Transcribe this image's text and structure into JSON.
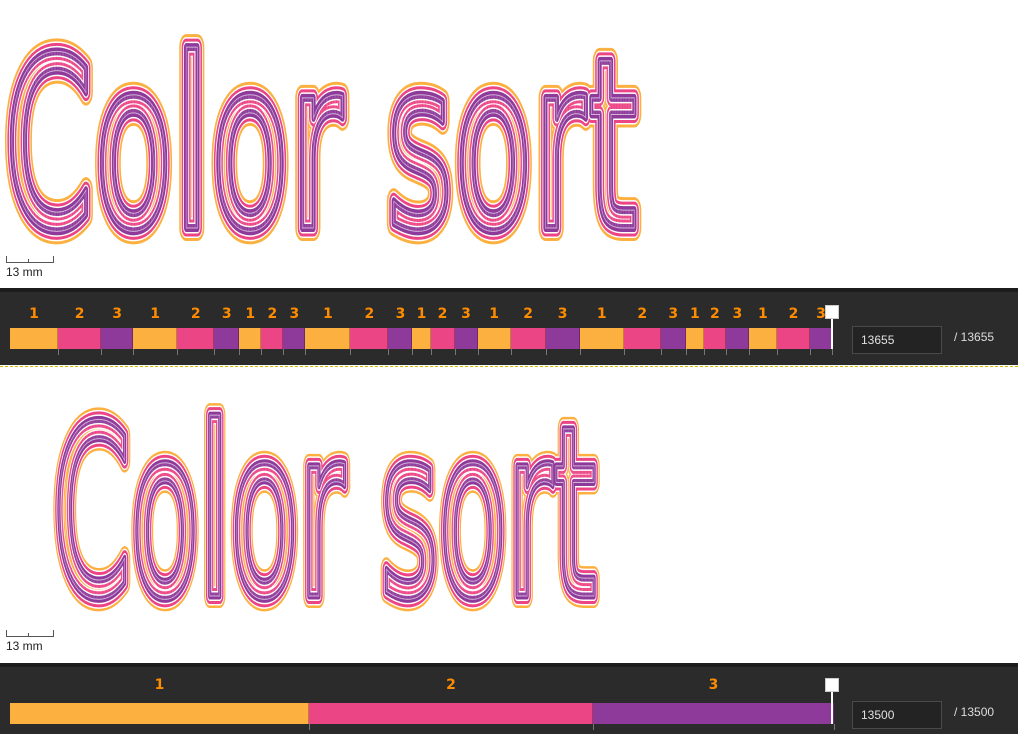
{
  "colors": {
    "orange": "#fbb040",
    "pink": "#ec4585",
    "purple": "#8e3a9a",
    "orange_label": "#ff8c00",
    "bg_dark": "#2b2b2b"
  },
  "design_text": "Color sort",
  "top_view": {
    "scale_label": "13 mm",
    "stitch_value": "13655",
    "stitch_total": "/ 13655",
    "segments": [
      1,
      2,
      3,
      1,
      2,
      3,
      1,
      2,
      3,
      1,
      2,
      3,
      1,
      2,
      3,
      1,
      2,
      3,
      1,
      2,
      3,
      1,
      2,
      3,
      1,
      2,
      3
    ],
    "segment_weights": [
      48,
      43,
      32,
      44,
      37,
      25,
      22,
      22,
      22,
      45,
      38,
      24,
      18,
      24,
      23,
      33,
      35,
      34,
      44,
      37,
      25,
      18,
      22,
      23,
      28,
      33,
      22
    ],
    "progress": 1.0
  },
  "bottom_view": {
    "scale_label": "13 mm",
    "stitch_value": "13500",
    "stitch_total": "/ 13500",
    "segments": [
      1,
      2,
      3
    ],
    "segment_weights": [
      299,
      284,
      241
    ],
    "progress": 1.0
  }
}
